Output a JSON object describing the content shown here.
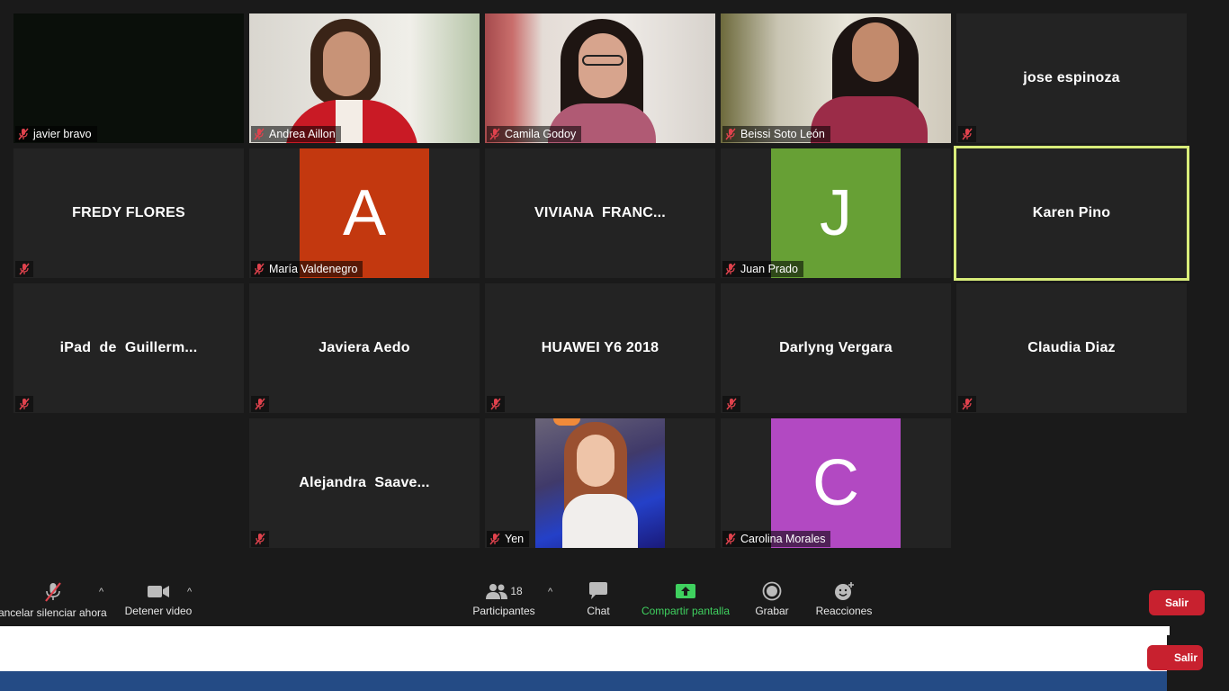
{
  "participants": [
    {
      "name": "javier bravo",
      "kind": "video-dark"
    },
    {
      "name": "Andrea Aillon",
      "kind": "video"
    },
    {
      "name": "Camila Godoy",
      "kind": "video"
    },
    {
      "name": "Beissi Soto León",
      "kind": "video"
    },
    {
      "name": "jose espinoza",
      "kind": "name-only"
    },
    {
      "name": "FREDY FLORES",
      "kind": "name-only"
    },
    {
      "name": "María Valdenegro",
      "kind": "avatar",
      "initial": "A",
      "color": "#c3380f"
    },
    {
      "name": "VIVIANA  FRANC...",
      "kind": "name-only"
    },
    {
      "name": "Juan Prado",
      "kind": "avatar",
      "initial": "J",
      "color": "#67a035"
    },
    {
      "name": "Karen Pino",
      "kind": "name-only",
      "speaking": true
    },
    {
      "name": "iPad  de  Guillerm...",
      "kind": "name-only"
    },
    {
      "name": "Javiera Aedo",
      "kind": "name-only"
    },
    {
      "name": "HUAWEI Y6 2018",
      "kind": "name-only"
    },
    {
      "name": "Darlyng Vergara",
      "kind": "name-only"
    },
    {
      "name": "Claudia Diaz",
      "kind": "name-only"
    },
    {
      "name": "Alejandra  Saave...",
      "kind": "name-only"
    },
    {
      "name": "Yen",
      "kind": "video"
    },
    {
      "name": "Carolina Morales",
      "kind": "avatar",
      "initial": "C",
      "color": "#b249c2"
    }
  ],
  "toolbar": {
    "unmute_label": "Cancelar silenciar ahora",
    "video_label": "Detener video",
    "participants_label": "Participantes",
    "participants_count": "18",
    "chat_label": "Chat",
    "share_label": "Compartir pantalla",
    "record_label": "Grabar",
    "reactions_label": "Reacciones",
    "exit_label": "Salir",
    "exit_label_2": "Salir"
  },
  "colors": {
    "background": "#1a1a1a",
    "tile": "#232323",
    "speaker_border": "#d8ec7a",
    "share_green": "#3fd15f",
    "exit_red": "#c8212f",
    "muted_red": "#e0424d"
  }
}
